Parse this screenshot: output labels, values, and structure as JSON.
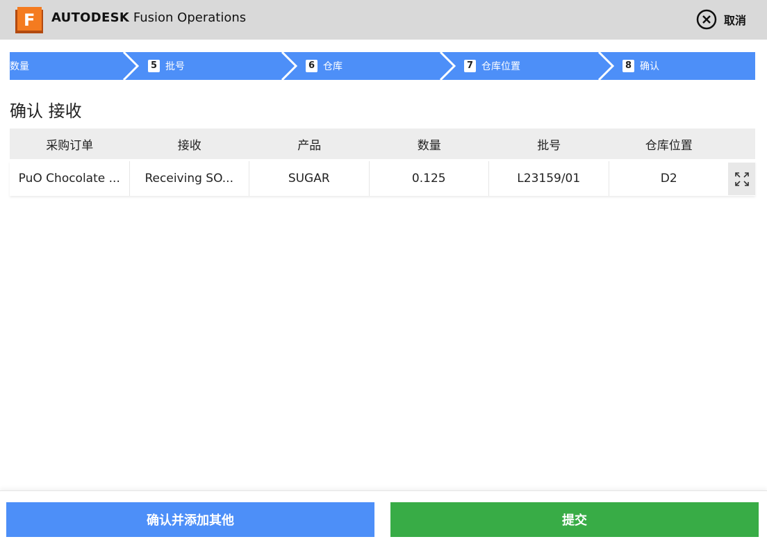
{
  "header": {
    "brand_bold": "AUTODESK",
    "brand_rest": "Fusion Operations",
    "logo_letter": "F",
    "cancel_label": "取消"
  },
  "stepper": {
    "accent": "#4d8ff8",
    "steps": [
      {
        "num": "",
        "label": "数量"
      },
      {
        "num": "5",
        "label": "批号"
      },
      {
        "num": "6",
        "label": "仓库"
      },
      {
        "num": "7",
        "label": "仓库位置"
      },
      {
        "num": "8",
        "label": "确认"
      }
    ]
  },
  "page": {
    "title": "确认 接收"
  },
  "table": {
    "headers": [
      "采购订单",
      "接收",
      "产品",
      "数量",
      "批号",
      "仓库位置"
    ],
    "rows": [
      [
        "PuO Chocolate ...",
        "Receiving SO...",
        "SUGAR",
        "0.125",
        "L23159/01",
        "D2"
      ]
    ],
    "expand_icon": "expand-icon"
  },
  "footer": {
    "confirm_add_label": "确认并添加其他",
    "submit_label": "提交",
    "confirm_color": "#4d8ff8",
    "submit_color": "#38ac46"
  }
}
